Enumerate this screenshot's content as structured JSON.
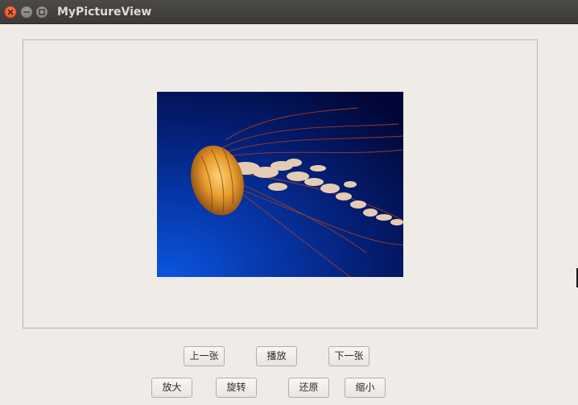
{
  "window": {
    "title": "MyPictureView"
  },
  "viewer": {
    "image_description_icon": "jellyfish-photo"
  },
  "buttons": {
    "prev": "上一张",
    "play": "播放",
    "next": "下一张",
    "zoom_in": "放大",
    "rotate": "旋转",
    "restore": "还原",
    "zoom_out": "缩小"
  },
  "colors": {
    "titlebar": "#3f3e3a",
    "close_button": "#e9541f",
    "window_bg": "#efebe7",
    "image_deep_blue": "#020a3a",
    "image_bright_blue": "#0a4fd0"
  }
}
